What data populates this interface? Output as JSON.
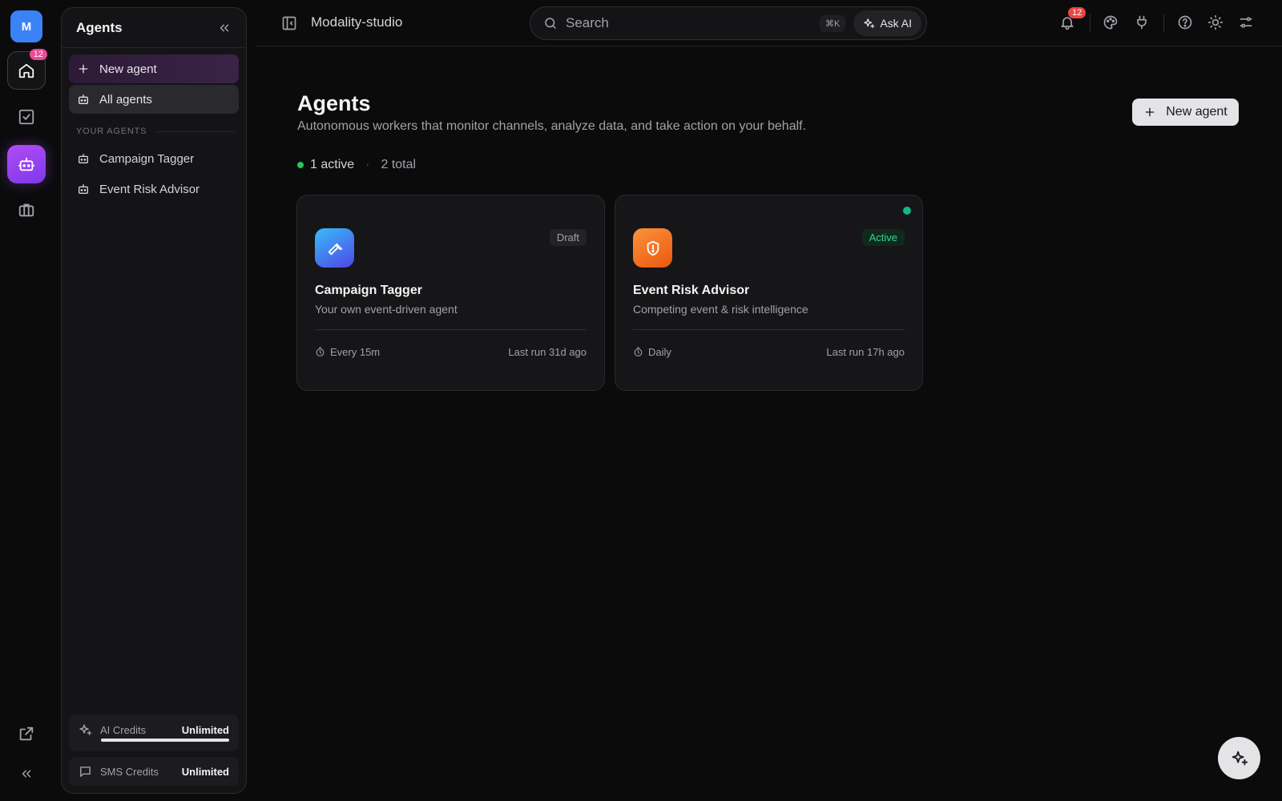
{
  "rail": {
    "avatar": "M",
    "home_badge": "12"
  },
  "panel": {
    "title": "Agents",
    "new_agent": "New agent",
    "all_agents": "All agents",
    "section_label": "YOUR AGENTS",
    "agents": [
      "Campaign Tagger",
      "Event Risk Advisor"
    ],
    "credits": [
      {
        "label": "AI Credits",
        "value": "Unlimited"
      },
      {
        "label": "SMS Credits",
        "value": "Unlimited"
      }
    ]
  },
  "topbar": {
    "workspace": "Modality-studio",
    "search_placeholder": "Search",
    "shortcut": "⌘K",
    "ask_ai": "Ask AI",
    "notification_count": "12"
  },
  "main": {
    "title": "Agents",
    "subtitle": "Autonomous workers that monitor channels, analyze data, and take action on your behalf.",
    "new_agent": "New agent",
    "active_count": "1 active",
    "separator": "·",
    "total_count": "2 total",
    "cards": [
      {
        "name": "Campaign Tagger",
        "description": "Your own event-driven agent",
        "status": "Draft",
        "schedule": "Every 15m",
        "last_run": "Last run 31d ago",
        "icon": "wrench-icon"
      },
      {
        "name": "Event Risk Advisor",
        "description": "Competing event & risk intelligence",
        "status": "Active",
        "schedule": "Daily",
        "last_run": "Last run 17h ago",
        "icon": "shield-icon"
      }
    ]
  },
  "colors": {
    "accent_purple": "#a855f7",
    "active_green": "#10b981",
    "avatar_blue": "#3b82f6",
    "badge_pink": "#ec4899",
    "badge_red": "#ef4444"
  }
}
